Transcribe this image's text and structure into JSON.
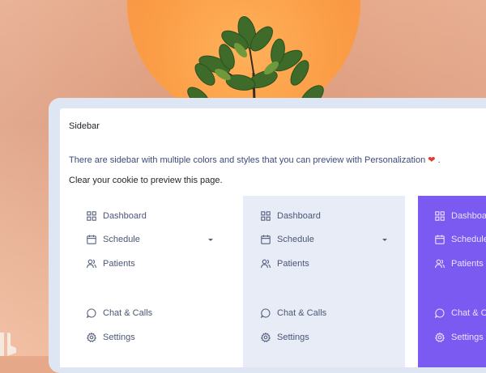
{
  "card": {
    "title": "Sidebar",
    "description": "There are sidebar with multiple colors and styles that you can preview with Personalization",
    "description_suffix": ".",
    "note": "Clear your cookie to preview this page."
  },
  "sidebar_variants": [
    {
      "theme": "light",
      "background": "#ffffff",
      "items": [
        {
          "label": "Dashboard",
          "icon": "dashboard-icon"
        },
        {
          "label": "Schedule",
          "icon": "calendar-icon",
          "has_dropdown": true
        },
        {
          "label": "Patients",
          "icon": "users-icon"
        },
        {
          "label": "Chat & Calls",
          "icon": "chat-icon"
        },
        {
          "label": "Settings",
          "icon": "gear-icon"
        }
      ]
    },
    {
      "theme": "soft-blue",
      "background": "#e7ecf7",
      "items": [
        {
          "label": "Dashboard",
          "icon": "dashboard-icon"
        },
        {
          "label": "Schedule",
          "icon": "calendar-icon",
          "has_dropdown": true
        },
        {
          "label": "Patients",
          "icon": "users-icon"
        },
        {
          "label": "Chat & Calls",
          "icon": "chat-icon"
        },
        {
          "label": "Settings",
          "icon": "gear-icon"
        }
      ]
    },
    {
      "theme": "purple",
      "background": "#7a5af0",
      "items": [
        {
          "label": "Dashboard",
          "icon": "dashboard-icon"
        },
        {
          "label": "Schedule",
          "icon": "calendar-icon"
        },
        {
          "label": "Patients",
          "icon": "users-icon"
        },
        {
          "label": "Chat & Ca",
          "icon": "chat-icon"
        },
        {
          "label": "Settings",
          "icon": "gear-icon"
        }
      ]
    }
  ]
}
